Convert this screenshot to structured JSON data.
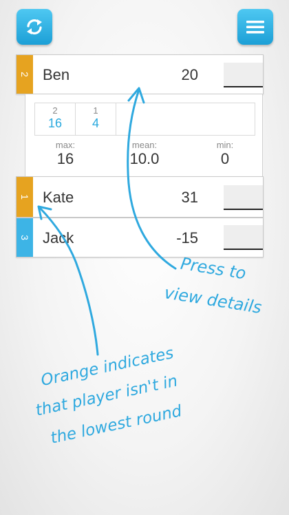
{
  "topbar": {
    "refresh_icon": "refresh-icon",
    "menu_icon": "hamburger-menu-icon"
  },
  "colors": {
    "accent_blue": "#3db4e6",
    "orange": "#e6a320"
  },
  "players": [
    {
      "rank": "2",
      "name": "Ben",
      "score": "20",
      "rank_color": "orange",
      "input_value": ""
    },
    {
      "rank": "1",
      "name": "Kate",
      "score": "31",
      "rank_color": "orange",
      "input_value": ""
    },
    {
      "rank": "3",
      "name": "Jack",
      "score": "-15",
      "rank_color": "blue",
      "input_value": ""
    }
  ],
  "details": {
    "rounds": [
      {
        "round": "2",
        "value": "16"
      },
      {
        "round": "1",
        "value": "4"
      }
    ],
    "stats": [
      {
        "label": "max:",
        "value": "16"
      },
      {
        "label": "mean:",
        "value": "10.0"
      },
      {
        "label": "min:",
        "value": "0"
      }
    ]
  },
  "annotations": {
    "press_line1": "Press to",
    "press_line2": "view details",
    "orange_line1": "Orange indicates",
    "orange_line2": "that player isn't in",
    "orange_line3": "the lowest round"
  }
}
